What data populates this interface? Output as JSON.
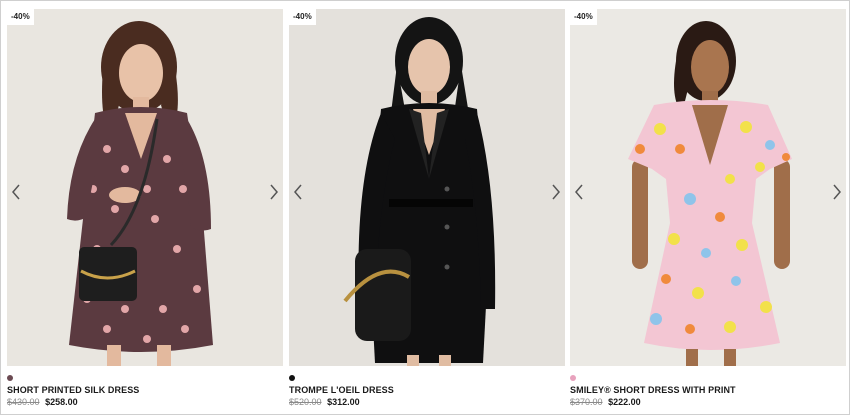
{
  "products": [
    {
      "badge": "-40%",
      "name": "SHORT PRINTED SILK DRESS",
      "old_price": "$430.00",
      "new_price": "$258.00",
      "swatch_color": "#6b4a52",
      "image_icon": "model-photo-printed-silk-dress"
    },
    {
      "badge": "-40%",
      "name": "TROMPE L'OEIL DRESS",
      "old_price": "$520.00",
      "new_price": "$312.00",
      "swatch_color": "#111111",
      "image_icon": "model-photo-black-blazer-dress"
    },
    {
      "badge": "-40%",
      "name": "SMILEY® SHORT DRESS WITH PRINT",
      "old_price": "$370.00",
      "new_price": "$222.00",
      "swatch_color": "#e8a2bd",
      "image_icon": "model-photo-smiley-print-dress"
    }
  ],
  "carousel": {
    "prev_icon": "chevron-left-icon",
    "next_icon": "chevron-right-icon"
  },
  "colors": {
    "badge_bg": "#ffffff",
    "strike_price": "#8a8a8a",
    "text": "#1a1a1a"
  }
}
